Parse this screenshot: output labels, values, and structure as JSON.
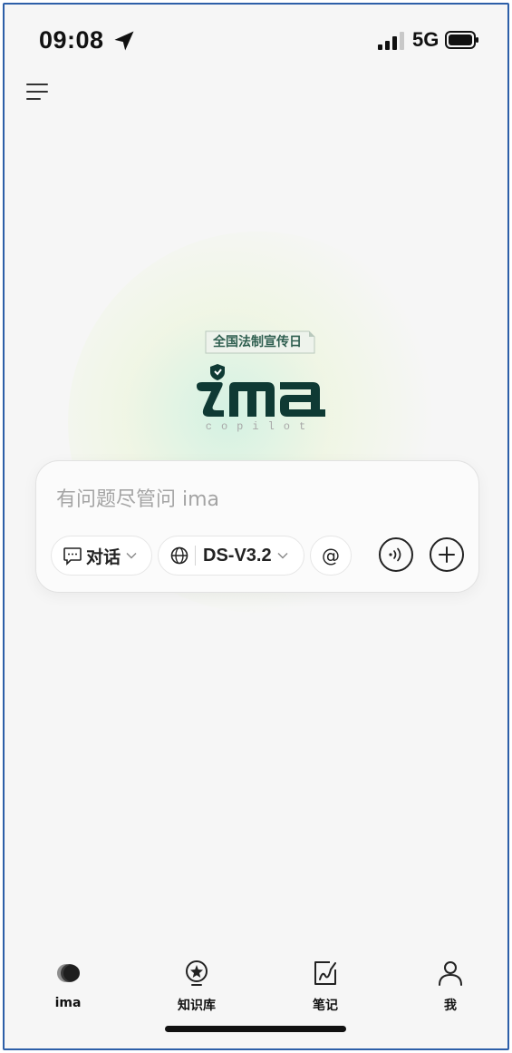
{
  "status_bar": {
    "time": "09:08",
    "network": "5G"
  },
  "logo": {
    "badge": "全国法制宣传日",
    "name": "ima",
    "subtitle": "copilot"
  },
  "input": {
    "placeholder": "有问题尽管问 ima"
  },
  "toolbar": {
    "mode_label": "对话",
    "model_label": "DS-V3.2",
    "mention_label": "@"
  },
  "nav": {
    "items": [
      {
        "label": "ima",
        "icon": "ima-logo-icon"
      },
      {
        "label": "知识库",
        "icon": "knowledge-icon"
      },
      {
        "label": "笔记",
        "icon": "notes-icon"
      },
      {
        "label": "我",
        "icon": "profile-icon"
      }
    ]
  },
  "colors": {
    "frame_border": "#2d5fa8",
    "logo_dark": "#0f3a34",
    "background": "#f6f6f6"
  }
}
